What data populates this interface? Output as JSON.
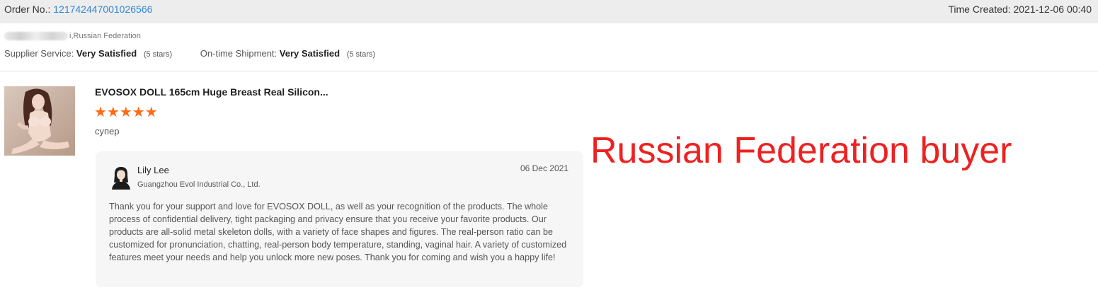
{
  "order": {
    "label": "Order No.:",
    "number": "121742447001026566",
    "time_created_label": "Time Created:",
    "time_created": "2021-12-06 00:40"
  },
  "buyer": {
    "location_suffix": "i,Russian Federation"
  },
  "ratings": {
    "supplier_label": "Supplier Service:",
    "supplier_value": "Very Satisfied",
    "supplier_stars": "(5 stars)",
    "shipment_label": "On-time Shipment:",
    "shipment_value": "Very Satisfied",
    "shipment_stars": "(5 stars)"
  },
  "product": {
    "title": "EVOSOX DOLL 165cm Huge Breast Real Silicon...",
    "star_rating": 5,
    "stars_text": "★★★★★",
    "review": "супер",
    "thumbnail_icon": "product-photo"
  },
  "reply": {
    "name": "Lily Lee",
    "company": "Guangzhou Evol Industrial Co., Ltd.",
    "date": "06 Dec 2021",
    "text": "Thank you for your support and love for EVOSOX DOLL, as well as your recognition of the products. The whole process of confidential delivery, tight packaging and privacy ensure that you receive your favorite products. Our products are all-solid metal skeleton dolls, with a variety of face shapes and figures. The real-person ratio can be customized for pronunciation, chatting, real-person body temperature, standing, vaginal hair. A variety of customized features meet your needs and help you unlock more new poses. Thank you for coming and wish you a happy life!"
  },
  "overlay": {
    "text": "Russian Federation buyer"
  },
  "colors": {
    "accent_link": "#2f86d6",
    "star": "#ff6a14",
    "overlay_red": "#ec2222",
    "topbar_bg": "#ededed",
    "reply_bg": "#f6f6f6"
  }
}
